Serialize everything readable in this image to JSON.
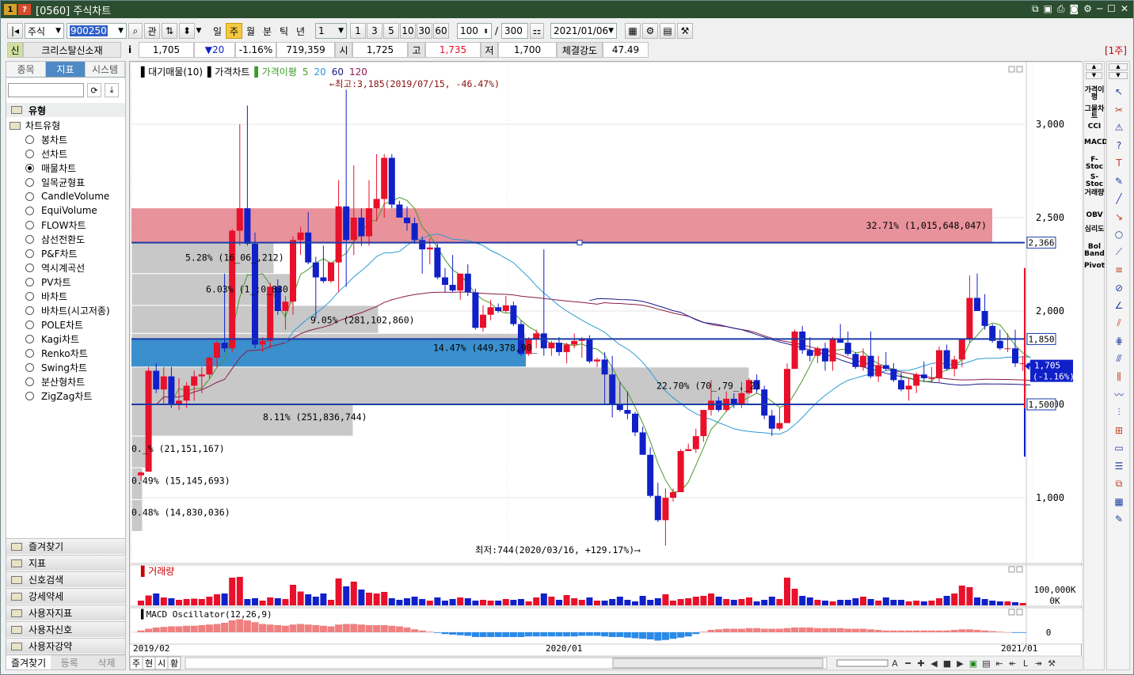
{
  "window": {
    "app_icons": [
      "1",
      "?"
    ],
    "title": "[0560] 주식차트"
  },
  "toolbar": {
    "market": "주식",
    "code": "900250",
    "btn_gwan": "관",
    "periods": [
      "일",
      "주",
      "월",
      "분",
      "틱",
      "년"
    ],
    "active_period": "주",
    "interval_value": "1",
    "interval_buttons": [
      "1",
      "3",
      "5",
      "10",
      "30",
      "60"
    ],
    "count_view": "100",
    "slash": "/",
    "count_total": "300",
    "date": "2021/01/06"
  },
  "quote": {
    "badge": "신",
    "name": "크리스탈신소재",
    "info": "i",
    "price": "1,705",
    "change": "▼20",
    "change_rate": "-1.16%",
    "volume": "719,359",
    "open_label": "시",
    "open": "1,725",
    "high_label": "고",
    "high": "1,735",
    "low_label": "저",
    "low": "1,700",
    "strength_label": "체결강도",
    "strength": "47.49",
    "period_tag": "[1주]"
  },
  "sidebar": {
    "tabs": [
      "종목",
      "지표",
      "시스템"
    ],
    "active_tab": "지표",
    "section_type": "유형",
    "tree_root": "차트유형",
    "chart_types": [
      "봉차트",
      "선차트",
      "매물차트",
      "일목균형표",
      "CandleVolume",
      "EquiVolume",
      "FLOW차트",
      "삼선전환도",
      "P&F차트",
      "역시계곡선",
      "PV차트",
      "바차트",
      "바차트(시고저종)",
      "POLE차트",
      "Kagi차트",
      "Renko차트",
      "Swing차트",
      "분산형차트",
      "ZigZag차트"
    ],
    "selected_type": "매물차트",
    "folders": [
      "즐겨찾기",
      "지표",
      "신호검색",
      "강세약세",
      "사용자지표",
      "사용자신호",
      "사용자강약"
    ],
    "bottom_tabs": [
      "즐겨찾기",
      "등록",
      "삭제"
    ]
  },
  "chart": {
    "legend": {
      "vol_profile": "▌대기매물(10)",
      "price": "▌가격차트",
      "ma": "▌가격이평",
      "ma_periods": [
        "5",
        "20",
        "60",
        "120"
      ]
    },
    "annotations": {
      "high": "←최고:3,185(2019/07/15, -46.47%)",
      "low": "최저:744(2020/03/16, +129.17%)⟶"
    },
    "price_axis": [
      "3,000",
      "2,500",
      "2,000",
      "1,500",
      "1,000"
    ],
    "markers": {
      "line1": "2,366",
      "line2": "1,850",
      "line3": "1,500",
      "current": "1,705",
      "current_rate": "(-1.16%)"
    },
    "volume_profile": [
      {
        "label": "32.71% (1,015,648,047)"
      },
      {
        "label": "5.28% (16_06_,212)"
      },
      {
        "label": "6.03% (1_;0_830"
      },
      {
        "label": "9.05% (281,102,860)"
      },
      {
        "label": "14.47% (449,378,90_"
      },
      {
        "label": "22.70% (70_,79_,_2)"
      },
      {
        "label": "8.11% (251,836,744)"
      },
      {
        "label": "0._% (21,151,167)"
      },
      {
        "label": "0.49% (15,145,693)"
      },
      {
        "label": "0.48% (14,830,036)"
      }
    ],
    "volume_pane": {
      "title": "▌거래량",
      "axis_top": "100,000K",
      "axis_zero": "0K"
    },
    "macd_pane": {
      "title": "▌MACD Oscillator(12,26,9)",
      "axis_zero": "0"
    },
    "x_axis": [
      "2019/02",
      "2020/01",
      "2021/01"
    ],
    "bottom_tabs": [
      "주",
      "현",
      "시",
      "황"
    ]
  },
  "right_indicators": [
    "가격이평",
    "그물차트",
    "CCI",
    "MACD",
    "F-Stoc",
    "S-Stoc",
    "거래량",
    "OBV",
    "심리도",
    "Bol Band",
    "Pivot"
  ],
  "colors": {
    "up": "#e8102a",
    "down": "#1020c8",
    "title_bg": "#2c4e30",
    "accent_tab": "#4d8ac6",
    "resist_band": "#e8929c",
    "support_band": "#3b8fcc"
  },
  "chart_data": {
    "type": "candlestick",
    "x": [
      "2019/02",
      "2020/01",
      "2021/01"
    ],
    "ylim": [
      700,
      3300
    ],
    "candles": [
      [
        1120,
        1140,
        1090,
        1135
      ],
      [
        1140,
        1700,
        1140,
        1680
      ],
      [
        1680,
        1720,
        1560,
        1580
      ],
      [
        1580,
        1700,
        1500,
        1650
      ],
      [
        1650,
        1700,
        1480,
        1500
      ],
      [
        1500,
        1640,
        1470,
        1520
      ],
      [
        1520,
        1620,
        1480,
        1600
      ],
      [
        1600,
        1680,
        1520,
        1650
      ],
      [
        1650,
        1700,
        1560,
        1660
      ],
      [
        1660,
        1760,
        1640,
        1750
      ],
      [
        1750,
        1840,
        1700,
        1830
      ],
      [
        1830,
        2200,
        1780,
        1800
      ],
      [
        1800,
        2440,
        1780,
        2430
      ],
      [
        2430,
        3000,
        2350,
        2550
      ],
      [
        2550,
        3100,
        2350,
        2360
      ],
      [
        2360,
        2420,
        1800,
        1820
      ],
      [
        1820,
        1860,
        1780,
        1840
      ],
      [
        1840,
        2150,
        1800,
        2130
      ],
      [
        2130,
        2170,
        1980,
        2000
      ],
      [
        2000,
        2080,
        1900,
        2050
      ],
      [
        2050,
        2400,
        1980,
        2380
      ],
      [
        2380,
        2450,
        2300,
        2420
      ],
      [
        2420,
        2530,
        2250,
        2260
      ],
      [
        2260,
        2290,
        1960,
        2180
      ],
      [
        2180,
        2350,
        2150,
        2160
      ],
      [
        2160,
        2260,
        2150,
        2260
      ],
      [
        2260,
        2700,
        2100,
        2560
      ],
      [
        2560,
        3185,
        2130,
        2380
      ],
      [
        2380,
        2780,
        2300,
        2500
      ],
      [
        2500,
        2550,
        2350,
        2400
      ],
      [
        2400,
        2700,
        2350,
        2550
      ],
      [
        2550,
        2840,
        2480,
        2600
      ],
      [
        2600,
        2840,
        2500,
        2820
      ],
      [
        2820,
        2840,
        2550,
        2570
      ],
      [
        2570,
        2590,
        2500,
        2500
      ],
      [
        2500,
        2560,
        2430,
        2470
      ],
      [
        2470,
        2500,
        2360,
        2380
      ],
      [
        2380,
        2400,
        2200,
        2330
      ],
      [
        2330,
        2390,
        2250,
        2340
      ],
      [
        2340,
        2360,
        2170,
        2180
      ],
      [
        2180,
        2230,
        2100,
        2140
      ],
      [
        2140,
        2300,
        2100,
        2110
      ],
      [
        2110,
        2200,
        2060,
        2200
      ],
      [
        2200,
        2250,
        2080,
        2100
      ],
      [
        2100,
        2120,
        1900,
        1910
      ],
      [
        1910,
        2030,
        1890,
        1980
      ],
      [
        1980,
        2060,
        1950,
        2020
      ],
      [
        2020,
        2040,
        1990,
        2000
      ],
      [
        2000,
        2080,
        1990,
        2030
      ],
      [
        2030,
        2050,
        1920,
        1930
      ],
      [
        1930,
        1950,
        1760,
        1770
      ],
      [
        1770,
        1860,
        1760,
        1850
      ],
      [
        1850,
        1900,
        1800,
        1880
      ],
      [
        1880,
        2330,
        1760,
        1800
      ],
      [
        1800,
        1840,
        1760,
        1830
      ],
      [
        1830,
        1860,
        1760,
        1780
      ],
      [
        1780,
        1830,
        1720,
        1820
      ],
      [
        1820,
        1880,
        1800,
        1840
      ],
      [
        1840,
        1860,
        1750,
        1850
      ],
      [
        1850,
        1870,
        1720,
        1730
      ],
      [
        1730,
        1750,
        1700,
        1740
      ],
      [
        1740,
        1780,
        1500,
        1660
      ],
      [
        1660,
        1760,
        1430,
        1500
      ],
      [
        1500,
        1620,
        1460,
        1470
      ],
      [
        1470,
        1570,
        1420,
        1450
      ],
      [
        1450,
        1460,
        1330,
        1350
      ],
      [
        1350,
        1380,
        1230,
        1230
      ],
      [
        1230,
        1270,
        1000,
        1010
      ],
      [
        1010,
        1080,
        870,
        880
      ],
      [
        880,
        1050,
        744,
        1000
      ],
      [
        1000,
        1050,
        980,
        1030
      ],
      [
        1030,
        1260,
        1030,
        1250
      ],
      [
        1250,
        1290,
        1260,
        1260
      ],
      [
        1260,
        1370,
        1240,
        1330
      ],
      [
        1330,
        1470,
        1300,
        1470
      ],
      [
        1470,
        1630,
        1440,
        1520
      ],
      [
        1520,
        1540,
        1460,
        1470
      ],
      [
        1470,
        1570,
        1460,
        1530
      ],
      [
        1530,
        1560,
        1480,
        1500
      ],
      [
        1500,
        1620,
        1480,
        1560
      ],
      [
        1560,
        1640,
        1550,
        1630
      ],
      [
        1630,
        1660,
        1560,
        1580
      ],
      [
        1580,
        1600,
        1420,
        1440
      ],
      [
        1440,
        1470,
        1330,
        1370
      ],
      [
        1370,
        1480,
        1360,
        1400
      ],
      [
        1400,
        1720,
        1400,
        1690
      ],
      [
        1690,
        1900,
        1690,
        1890
      ],
      [
        1890,
        1920,
        1770,
        1790
      ],
      [
        1790,
        1860,
        1730,
        1760
      ],
      [
        1760,
        1810,
        1720,
        1800
      ],
      [
        1800,
        1830,
        1680,
        1730
      ],
      [
        1730,
        1860,
        1680,
        1850
      ],
      [
        1850,
        1930,
        1830,
        1830
      ],
      [
        1830,
        1890,
        1760,
        1770
      ],
      [
        1770,
        1780,
        1690,
        1700
      ],
      [
        1700,
        1800,
        1680,
        1760
      ],
      [
        1760,
        1890,
        1640,
        1650
      ],
      [
        1650,
        1760,
        1620,
        1710
      ],
      [
        1710,
        1780,
        1680,
        1690
      ],
      [
        1690,
        1720,
        1620,
        1630
      ],
      [
        1630,
        1670,
        1570,
        1580
      ],
      [
        1580,
        1640,
        1520,
        1600
      ],
      [
        1600,
        1670,
        1560,
        1660
      ],
      [
        1660,
        1730,
        1620,
        1640
      ],
      [
        1640,
        1700,
        1620,
        1640
      ],
      [
        1640,
        1810,
        1620,
        1790
      ],
      [
        1790,
        1820,
        1680,
        1690
      ],
      [
        1690,
        1760,
        1650,
        1740
      ],
      [
        1740,
        1850,
        1700,
        1850
      ],
      [
        1850,
        2190,
        1830,
        2070
      ],
      [
        2070,
        2200,
        2000,
        2000
      ],
      [
        2000,
        2090,
        1900,
        1920
      ],
      [
        1920,
        1930,
        1830,
        1840
      ],
      [
        1840,
        1900,
        1790,
        1800
      ],
      [
        1800,
        1880,
        1780,
        1800
      ],
      [
        1800,
        1900,
        1700,
        1720
      ],
      [
        1720,
        1760,
        1680,
        1720
      ],
      [
        1720,
        1735,
        1700,
        1705
      ]
    ],
    "volume": [
      12,
      25,
      30,
      20,
      18,
      14,
      16,
      17,
      16,
      22,
      28,
      30,
      70,
      72,
      16,
      18,
      12,
      20,
      18,
      16,
      52,
      35,
      28,
      22,
      30,
      14,
      68,
      48,
      60,
      40,
      32,
      30,
      34,
      18,
      14,
      18,
      22,
      16,
      12,
      20,
      12,
      16,
      20,
      18,
      12,
      14,
      12,
      12,
      16,
      14,
      16,
      10,
      20,
      30,
      22,
      14,
      26,
      18,
      14,
      20,
      12,
      12,
      16,
      22,
      14,
      10,
      24,
      14,
      18,
      28,
      12,
      16,
      18,
      22,
      24,
      30,
      22,
      16,
      14,
      16,
      20,
      10,
      14,
      22,
      16,
      70,
      42,
      24,
      20,
      14,
      12,
      10,
      14,
      14,
      18,
      22,
      16,
      12,
      20,
      14,
      14,
      10,
      12,
      10,
      12,
      18,
      24,
      30,
      50,
      46,
      20,
      16,
      12,
      10,
      10,
      8,
      6
    ],
    "macd": [
      3,
      6,
      8,
      9,
      10,
      10,
      11,
      11,
      12,
      13,
      14,
      16,
      20,
      22,
      20,
      17,
      14,
      13,
      12,
      11,
      13,
      14,
      13,
      12,
      11,
      10,
      13,
      14,
      14,
      13,
      12,
      12,
      12,
      11,
      10,
      8,
      5,
      3,
      1,
      -1,
      -3,
      -4,
      -5,
      -6,
      -8,
      -8,
      -8,
      -8,
      -8,
      -8,
      -8,
      -7,
      -7,
      -7,
      -7,
      -7,
      -7,
      -7,
      -6,
      -6,
      -6,
      -7,
      -8,
      -8,
      -9,
      -10,
      -11,
      -12,
      -14,
      -13,
      -11,
      -9,
      -7,
      -3,
      1,
      4,
      5,
      6,
      6,
      6,
      7,
      7,
      6,
      6,
      6,
      7,
      8,
      8,
      8,
      7,
      7,
      7,
      7,
      6,
      6,
      6,
      5,
      4,
      3,
      3,
      3,
      3,
      3,
      3,
      3,
      3,
      3,
      4,
      5,
      5,
      4,
      3,
      2,
      1,
      0,
      -1,
      -1
    ]
  }
}
